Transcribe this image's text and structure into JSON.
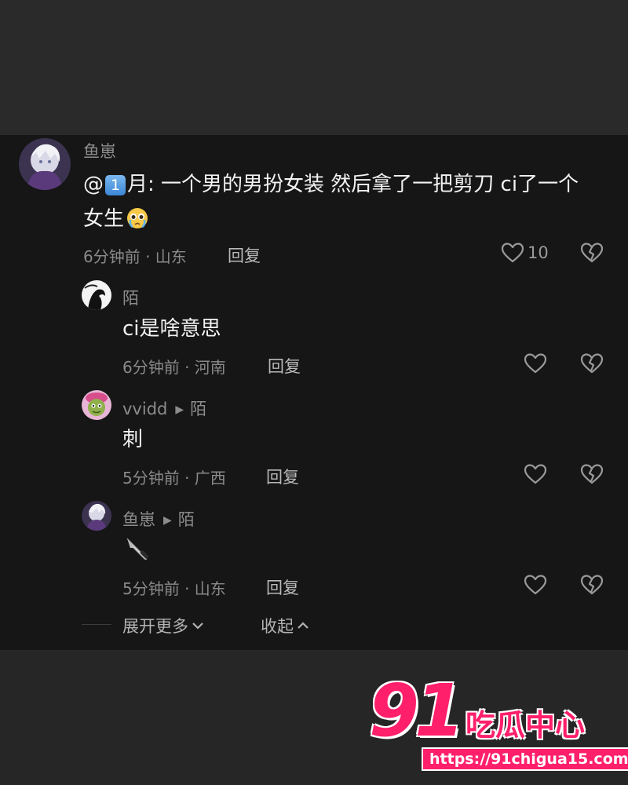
{
  "comments": {
    "main": {
      "username": "鱼崽",
      "mention_at": "@",
      "mention_badge": "1",
      "text_line1": "月: 一个男的男扮女装 然后拿了一把剪刀 ci了一个",
      "text_line2": "女生",
      "meta": "6分钟前 · 山东",
      "reply_label": "回复",
      "like_count": "10"
    },
    "replies": [
      {
        "username": "陌",
        "reply_to": "",
        "text": "ci是啥意思",
        "meta": "6分钟前 · 河南",
        "reply_label": "回复"
      },
      {
        "username": "vvidd",
        "reply_to": "陌",
        "text": "刺",
        "meta": "5分钟前 · 广西",
        "reply_label": "回复"
      },
      {
        "username": "鱼崽",
        "reply_to": "陌",
        "text": "🔪",
        "meta": "5分钟前 · 山东",
        "reply_label": "回复"
      }
    ],
    "expand_more_label": "展开更多",
    "collapse_label": "收起"
  },
  "icons": {
    "like": "heart-outline-icon",
    "dislike": "broken-heart-icon",
    "reply_arrow": "triangle-right-icon",
    "expand": "chevron-down-icon",
    "collapse": "chevron-up-icon",
    "crying_emoji": "pleading-face-icon"
  },
  "watermark": {
    "number": "91",
    "name": "吃瓜中心",
    "url": "https://91chigua15.com"
  },
  "colors": {
    "panel_bg": "#161616",
    "outer_bg": "#2a2a2a",
    "brand_pink": "#ff1f6b",
    "secondary_text": "#8c8c8c"
  }
}
